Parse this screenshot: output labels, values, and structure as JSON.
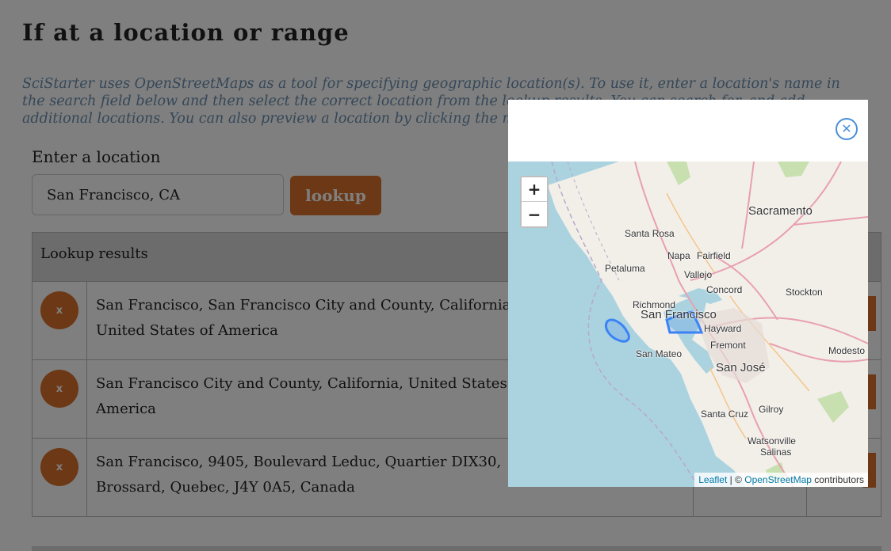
{
  "heading": "If at a location or range",
  "description": "SciStarter uses OpenStreetMaps as a tool for specifying geographic location(s). To use it, enter a location's name in the search field below and then select the correct location from the lookup results. You can search for, and add additional locations. You can also preview a location by clicking the map button.",
  "search": {
    "label": "Enter a location",
    "value": "San Francisco, CA",
    "button_label": "lookup"
  },
  "results": {
    "header": "Lookup results",
    "remove_label": "x",
    "rows": [
      {
        "text": "San Francisco, San Francisco City and County, California, United States of America"
      },
      {
        "text": "San Francisco City and County, California, United States of America"
      },
      {
        "text": "San Francisco, 9405, Boulevard Leduc, Quartier DIX30, Brossard, Quebec, J4Y 0A5, Canada"
      }
    ]
  },
  "modal": {
    "close_icon": "circle-x-icon",
    "zoom_in": "+",
    "zoom_out": "−",
    "attribution": {
      "leaflet": "Leaflet",
      "sep": " | © ",
      "osm": "OpenStreetMap",
      "suffix": " contributors"
    },
    "cities": {
      "sacramento": "Sacramento",
      "santa_rosa": "Santa Rosa",
      "napa": "Napa",
      "fairfield": "Fairfield",
      "petaluma": "Petaluma",
      "vallejo": "Vallejo",
      "concord": "Concord",
      "stockton": "Stockton",
      "richmond": "Richmond",
      "san_francisco": "San Francisco",
      "hayward": "Hayward",
      "fremont": "Fremont",
      "modesto": "Modesto",
      "san_mateo": "San Mateo",
      "san_jose": "San José",
      "santa_cruz": "Santa Cruz",
      "gilroy": "Gilroy",
      "watsonville": "Watsonville",
      "salinas": "Salinas"
    },
    "highlight_color": "#3b82f6"
  },
  "colors": {
    "accent": "#d9712a",
    "description_text": "#6a8fb0"
  }
}
